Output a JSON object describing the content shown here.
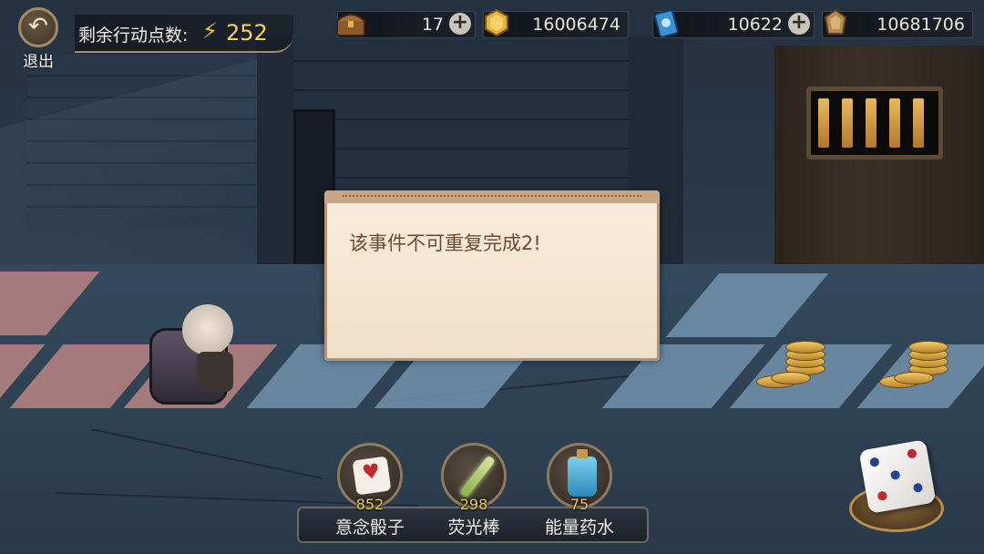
{
  "hud": {
    "exit_label": "退出",
    "action_points_label": "剩余行动点数:",
    "action_points_value": "252"
  },
  "resources": [
    {
      "icon": "treasure-chest-icon",
      "value": "17",
      "has_plus": true
    },
    {
      "icon": "gold-coin-icon",
      "value": "16006474",
      "has_plus": false
    },
    {
      "icon": "blue-card-icon",
      "value": "10622",
      "has_plus": true
    },
    {
      "icon": "bronze-token-icon",
      "value": "10681706",
      "has_plus": false
    }
  ],
  "dialog": {
    "message": "该事件不可重复完成2!"
  },
  "items": [
    {
      "name": "意念骰子",
      "count": "852",
      "icon": "heart-dice-icon"
    },
    {
      "name": "荧光棒",
      "count": "298",
      "icon": "glow-stick-icon"
    },
    {
      "name": "能量药水",
      "count": "75",
      "icon": "energy-potion-icon"
    }
  ],
  "colors": {
    "action_points": "#f4d36a",
    "item_count": "#e8cf63",
    "dialog_text": "#6a4b35",
    "tile_blue": "#6f8ea8",
    "tile_red": "#b98483"
  }
}
